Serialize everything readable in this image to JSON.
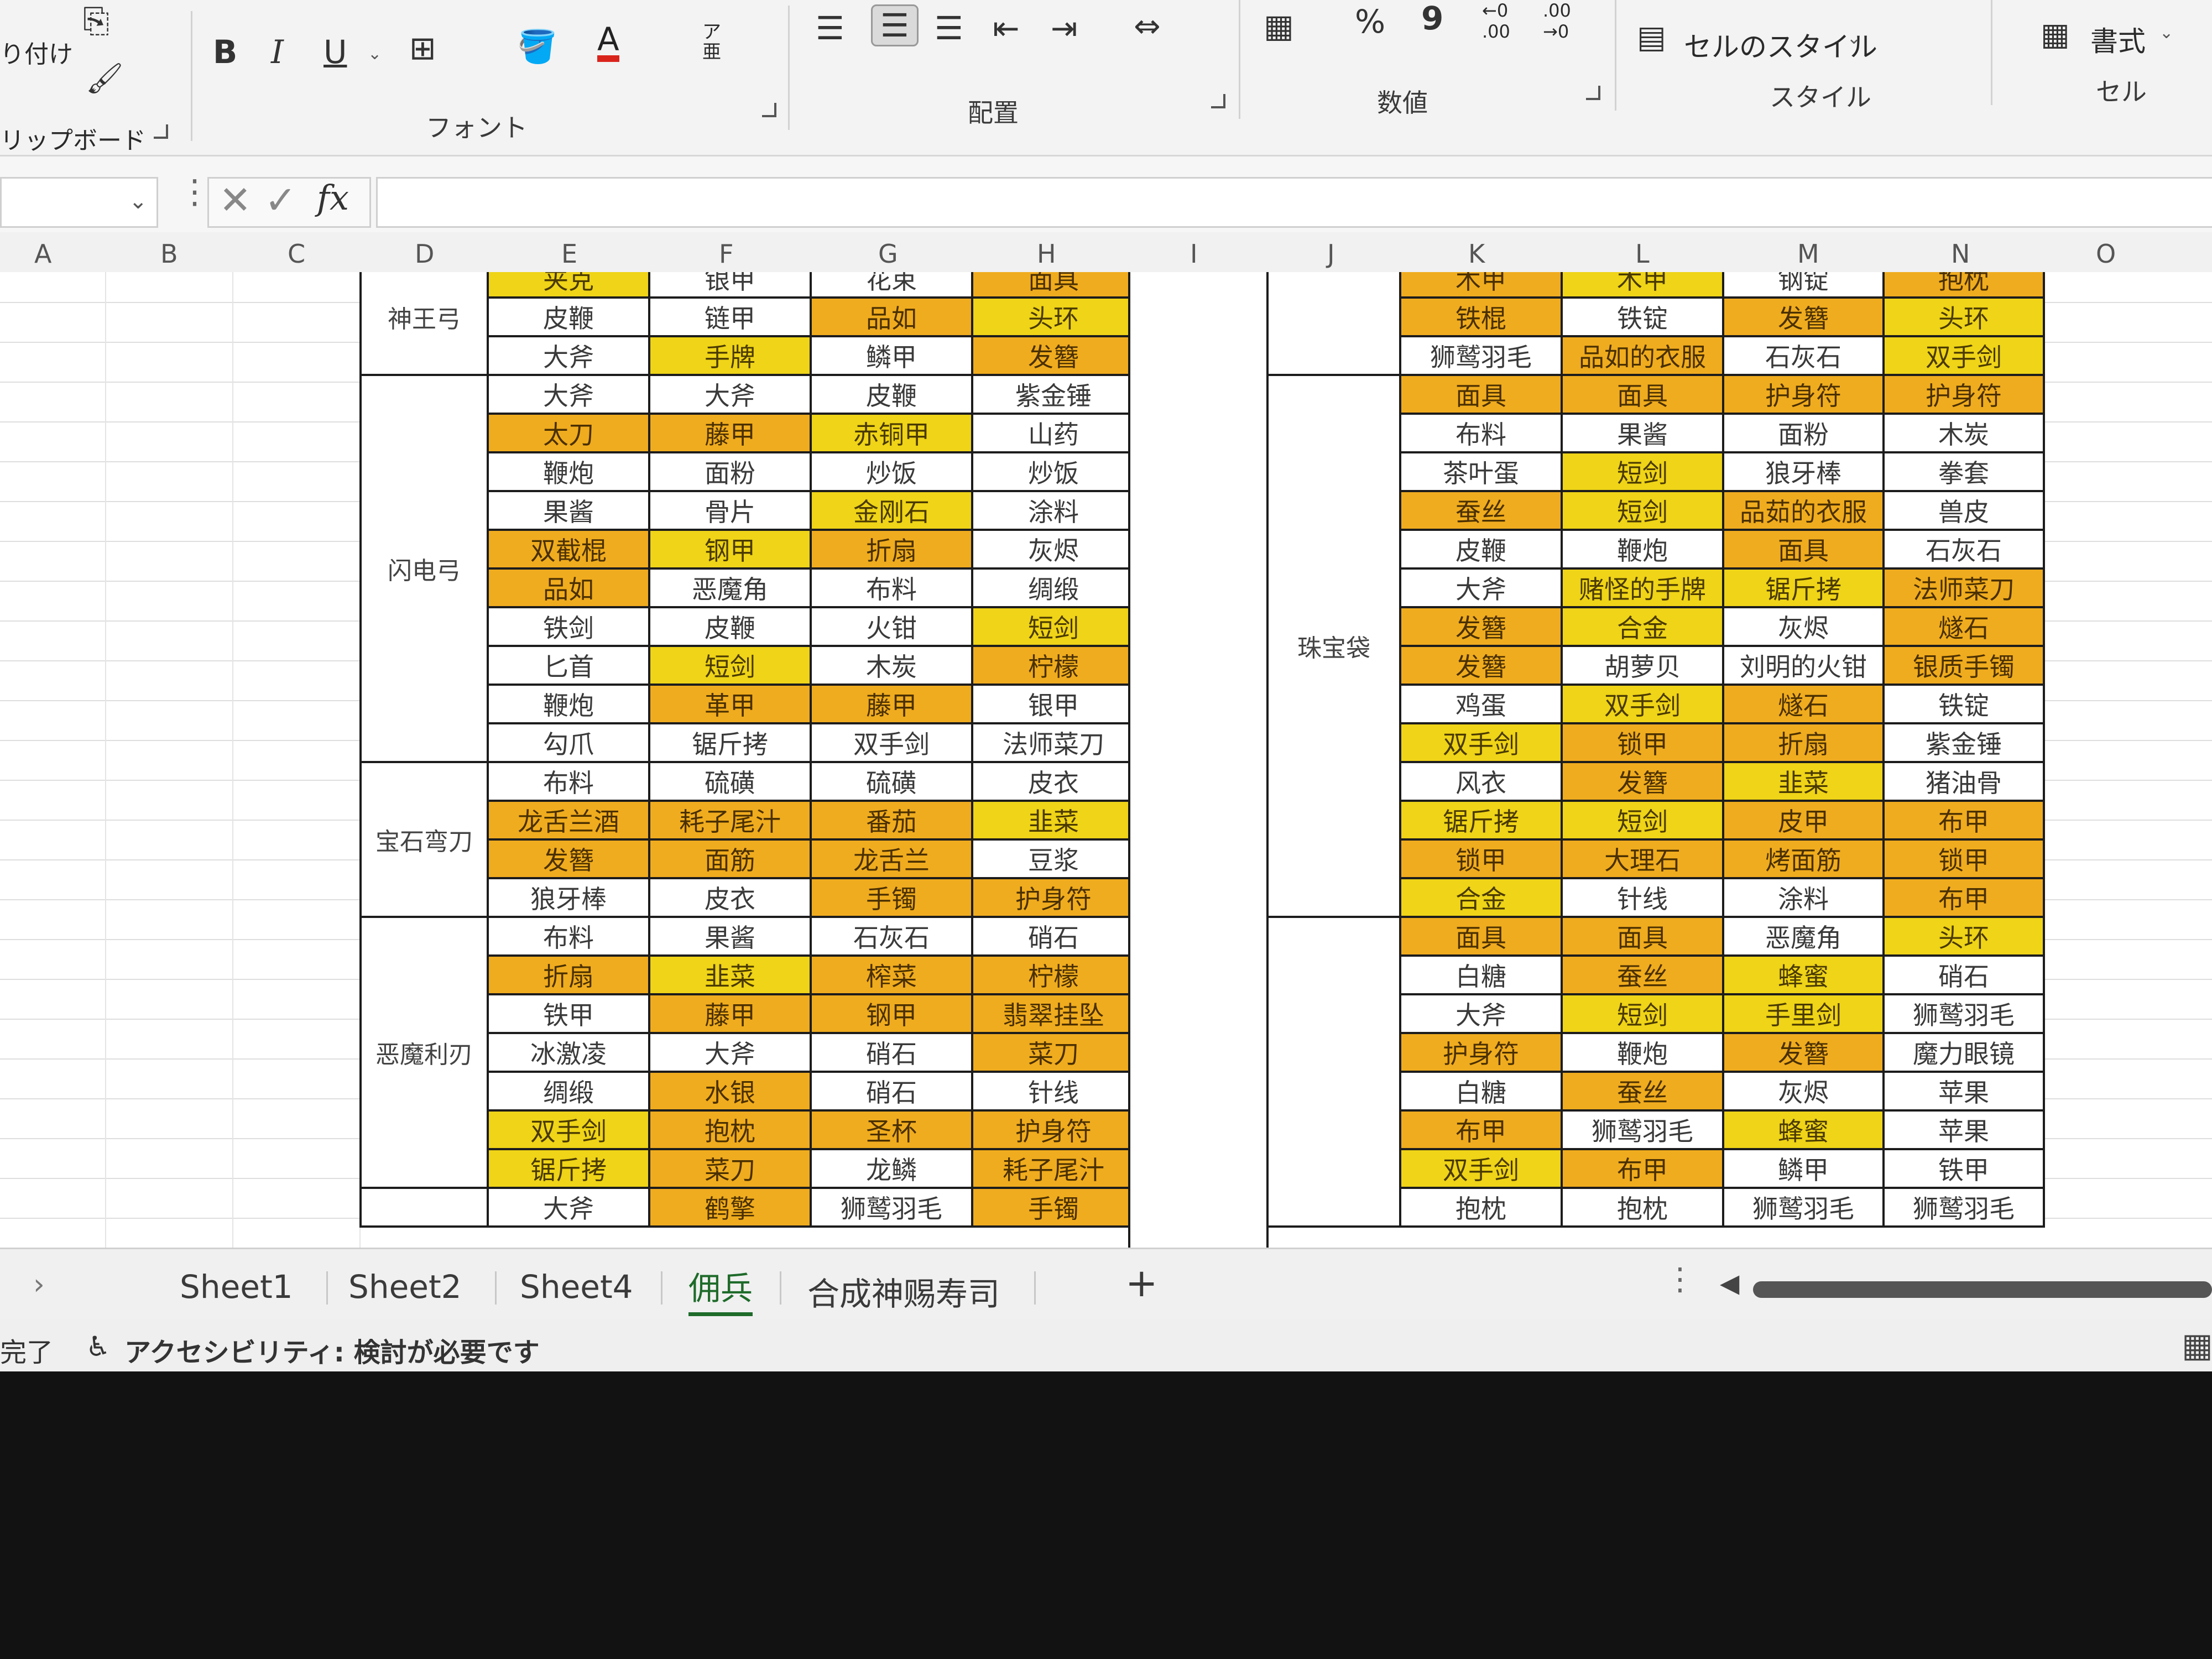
{
  "ribbon": {
    "paste_label": "り付け",
    "clipboard_group": "リップボード",
    "font_group": "フォント",
    "align_group": "配置",
    "number_group": "数値",
    "style_group": "スタイル",
    "cell_group": "セル",
    "bold": "B",
    "italic": "I",
    "underline": "U",
    "font_color": "A",
    "phonetic": "ア亜",
    "percent": "%",
    "comma": "9",
    "inc_decimal": "←0 .00",
    "dec_decimal": ".00 →0",
    "cell_styles": "セルのスタイル",
    "format": "書式"
  },
  "formula_bar": {
    "cancel": "✕",
    "enter": "✓",
    "fx": "fx",
    "value": ""
  },
  "column_headers": [
    "A",
    "B",
    "C",
    "D",
    "E",
    "F",
    "G",
    "H",
    "I",
    "J",
    "K",
    "L",
    "M",
    "N",
    "O"
  ],
  "left_table": {
    "groups": [
      {
        "name": "神王弓",
        "rows": 3
      },
      {
        "name": "闪电弓",
        "rows": 10
      },
      {
        "name": "宝石弯刀",
        "rows": 4
      },
      {
        "name": "恶魔利刃",
        "rows": 7
      },
      {
        "name": "",
        "rows": 1
      }
    ],
    "rows": [
      [
        [
          "夹克",
          "ye"
        ],
        [
          "银甲",
          "w"
        ],
        [
          "花束",
          "w"
        ],
        [
          "面具",
          "or"
        ]
      ],
      [
        [
          "皮鞭",
          "w"
        ],
        [
          "链甲",
          "w"
        ],
        [
          "品如",
          "or"
        ],
        [
          "头环",
          "ye"
        ]
      ],
      [
        [
          "大斧",
          "w"
        ],
        [
          "手牌",
          "ye"
        ],
        [
          "鳞甲",
          "w"
        ],
        [
          "发簪",
          "or"
        ]
      ],
      [
        [
          "大斧",
          "w"
        ],
        [
          "大斧",
          "w"
        ],
        [
          "皮鞭",
          "w"
        ],
        [
          "紫金锤",
          "w"
        ]
      ],
      [
        [
          "太刀",
          "or"
        ],
        [
          "藤甲",
          "or"
        ],
        [
          "赤铜甲",
          "ye"
        ],
        [
          "山药",
          "w"
        ]
      ],
      [
        [
          "鞭炮",
          "w"
        ],
        [
          "面粉",
          "w"
        ],
        [
          "炒饭",
          "w"
        ],
        [
          "炒饭",
          "w"
        ]
      ],
      [
        [
          "果酱",
          "w"
        ],
        [
          "骨片",
          "w"
        ],
        [
          "金刚石",
          "ye"
        ],
        [
          "涂料",
          "w"
        ]
      ],
      [
        [
          "双截棍",
          "or"
        ],
        [
          "钢甲",
          "ye"
        ],
        [
          "折扇",
          "or"
        ],
        [
          "灰烬",
          "w"
        ]
      ],
      [
        [
          "品如",
          "or"
        ],
        [
          "恶魔角",
          "w"
        ],
        [
          "布料",
          "w"
        ],
        [
          "绸缎",
          "w"
        ]
      ],
      [
        [
          "铁剑",
          "w"
        ],
        [
          "皮鞭",
          "w"
        ],
        [
          "火钳",
          "w"
        ],
        [
          "短剑",
          "ye"
        ]
      ],
      [
        [
          "匕首",
          "w"
        ],
        [
          "短剑",
          "ye"
        ],
        [
          "木炭",
          "w"
        ],
        [
          "柠檬",
          "or"
        ]
      ],
      [
        [
          "鞭炮",
          "w"
        ],
        [
          "革甲",
          "or"
        ],
        [
          "藤甲",
          "or"
        ],
        [
          "银甲",
          "w"
        ]
      ],
      [
        [
          "勾爪",
          "w"
        ],
        [
          "锯斤拷",
          "w"
        ],
        [
          "双手剑",
          "w"
        ],
        [
          "法师菜刀",
          "w"
        ]
      ],
      [
        [
          "布料",
          "w"
        ],
        [
          "硫磺",
          "w"
        ],
        [
          "硫磺",
          "w"
        ],
        [
          "皮衣",
          "w"
        ]
      ],
      [
        [
          "龙舌兰酒",
          "or"
        ],
        [
          "耗子尾汁",
          "or"
        ],
        [
          "番茄",
          "or"
        ],
        [
          "韭菜",
          "ye"
        ]
      ],
      [
        [
          "发簪",
          "or"
        ],
        [
          "面筋",
          "or"
        ],
        [
          "龙舌兰",
          "or"
        ],
        [
          "豆浆",
          "w"
        ]
      ],
      [
        [
          "狼牙棒",
          "w"
        ],
        [
          "皮衣",
          "w"
        ],
        [
          "手镯",
          "or"
        ],
        [
          "护身符",
          "or"
        ]
      ],
      [
        [
          "布料",
          "w"
        ],
        [
          "果酱",
          "w"
        ],
        [
          "石灰石",
          "w"
        ],
        [
          "硝石",
          "w"
        ]
      ],
      [
        [
          "折扇",
          "or"
        ],
        [
          "韭菜",
          "ye"
        ],
        [
          "榨菜",
          "or"
        ],
        [
          "柠檬",
          "or"
        ]
      ],
      [
        [
          "铁甲",
          "w"
        ],
        [
          "藤甲",
          "or"
        ],
        [
          "钢甲",
          "or"
        ],
        [
          "翡翠挂坠",
          "or"
        ]
      ],
      [
        [
          "冰激凌",
          "w"
        ],
        [
          "大斧",
          "w"
        ],
        [
          "硝石",
          "w"
        ],
        [
          "菜刀",
          "or"
        ]
      ],
      [
        [
          "绸缎",
          "w"
        ],
        [
          "水银",
          "or"
        ],
        [
          "硝石",
          "w"
        ],
        [
          "针线",
          "w"
        ]
      ],
      [
        [
          "双手剑",
          "ye"
        ],
        [
          "抱枕",
          "or"
        ],
        [
          "圣杯",
          "or"
        ],
        [
          "护身符",
          "or"
        ]
      ],
      [
        [
          "锯斤拷",
          "ye"
        ],
        [
          "菜刀",
          "or"
        ],
        [
          "龙鳞",
          "w"
        ],
        [
          "耗子尾汁",
          "or"
        ]
      ],
      [
        [
          "大斧",
          "w"
        ],
        [
          "鹤擎",
          "or"
        ],
        [
          "狮鹫羽毛",
          "w"
        ],
        [
          "手镯",
          "or"
        ]
      ]
    ]
  },
  "right_table": {
    "groups": [
      {
        "name": "",
        "rows": 3
      },
      {
        "name": "珠宝袋",
        "rows": 14
      },
      {
        "name": "",
        "rows": 8
      }
    ],
    "rows": [
      [
        [
          "木甲",
          "or"
        ],
        [
          "木甲",
          "ye"
        ],
        [
          "钢锭",
          "w"
        ],
        [
          "抱枕",
          "or"
        ]
      ],
      [
        [
          "铁棍",
          "or"
        ],
        [
          "铁锭",
          "w"
        ],
        [
          "发簪",
          "or"
        ],
        [
          "头环",
          "ye"
        ]
      ],
      [
        [
          "狮鹫羽毛",
          "w"
        ],
        [
          "品如的衣服",
          "or"
        ],
        [
          "石灰石",
          "w"
        ],
        [
          "双手剑",
          "ye"
        ]
      ],
      [
        [
          "面具",
          "or"
        ],
        [
          "面具",
          "or"
        ],
        [
          "护身符",
          "or"
        ],
        [
          "护身符",
          "or"
        ]
      ],
      [
        [
          "布料",
          "w"
        ],
        [
          "果酱",
          "w"
        ],
        [
          "面粉",
          "w"
        ],
        [
          "木炭",
          "w"
        ]
      ],
      [
        [
          "茶叶蛋",
          "w"
        ],
        [
          "短剑",
          "ye"
        ],
        [
          "狼牙棒",
          "w"
        ],
        [
          "拳套",
          "w"
        ]
      ],
      [
        [
          "蚕丝",
          "or"
        ],
        [
          "短剑",
          "ye"
        ],
        [
          "品茹的衣服",
          "or"
        ],
        [
          "兽皮",
          "w"
        ]
      ],
      [
        [
          "皮鞭",
          "w"
        ],
        [
          "鞭炮",
          "w"
        ],
        [
          "面具",
          "or"
        ],
        [
          "石灰石",
          "w"
        ]
      ],
      [
        [
          "大斧",
          "w"
        ],
        [
          "赌怪的手牌",
          "ye"
        ],
        [
          "锯斤拷",
          "ye"
        ],
        [
          "法师菜刀",
          "or"
        ]
      ],
      [
        [
          "发簪",
          "or"
        ],
        [
          "合金",
          "ye"
        ],
        [
          "灰烬",
          "w"
        ],
        [
          "燧石",
          "or"
        ]
      ],
      [
        [
          "发簪",
          "or"
        ],
        [
          "胡萝贝",
          "w"
        ],
        [
          "刘明的火钳",
          "w"
        ],
        [
          "银质手镯",
          "or"
        ]
      ],
      [
        [
          "鸡蛋",
          "w"
        ],
        [
          "双手剑",
          "ye"
        ],
        [
          "燧石",
          "or"
        ],
        [
          "铁锭",
          "w"
        ]
      ],
      [
        [
          "双手剑",
          "ye"
        ],
        [
          "锁甲",
          "or"
        ],
        [
          "折扇",
          "or"
        ],
        [
          "紫金锤",
          "w"
        ]
      ],
      [
        [
          "风衣",
          "w"
        ],
        [
          "发簪",
          "or"
        ],
        [
          "韭菜",
          "ye"
        ],
        [
          "猪油骨",
          "w"
        ]
      ],
      [
        [
          "锯斤拷",
          "ye"
        ],
        [
          "短剑",
          "ye"
        ],
        [
          "皮甲",
          "or"
        ],
        [
          "布甲",
          "or"
        ]
      ],
      [
        [
          "锁甲",
          "or"
        ],
        [
          "大理石",
          "or"
        ],
        [
          "烤面筋",
          "or"
        ],
        [
          "锁甲",
          "or"
        ]
      ],
      [
        [
          "合金",
          "ye"
        ],
        [
          "针线",
          "w"
        ],
        [
          "涂料",
          "w"
        ],
        [
          "布甲",
          "or"
        ]
      ],
      [
        [
          "面具",
          "or"
        ],
        [
          "面具",
          "or"
        ],
        [
          "恶魔角",
          "w"
        ],
        [
          "头环",
          "ye"
        ]
      ],
      [
        [
          "白糖",
          "w"
        ],
        [
          "蚕丝",
          "or"
        ],
        [
          "蜂蜜",
          "ye"
        ],
        [
          "硝石",
          "w"
        ]
      ],
      [
        [
          "大斧",
          "w"
        ],
        [
          "短剑",
          "ye"
        ],
        [
          "手里剑",
          "ye"
        ],
        [
          "狮鹫羽毛",
          "w"
        ]
      ],
      [
        [
          "护身符",
          "or"
        ],
        [
          "鞭炮",
          "w"
        ],
        [
          "发簪",
          "or"
        ],
        [
          "魔力眼镜",
          "w"
        ]
      ],
      [
        [
          "白糖",
          "w"
        ],
        [
          "蚕丝",
          "or"
        ],
        [
          "灰烬",
          "w"
        ],
        [
          "苹果",
          "w"
        ]
      ],
      [
        [
          "布甲",
          "or"
        ],
        [
          "狮鹫羽毛",
          "w"
        ],
        [
          "蜂蜜",
          "ye"
        ],
        [
          "苹果",
          "w"
        ]
      ],
      [
        [
          "双手剑",
          "ye"
        ],
        [
          "布甲",
          "or"
        ],
        [
          "鳞甲",
          "w"
        ],
        [
          "铁甲",
          "w"
        ]
      ],
      [
        [
          "抱枕",
          "w"
        ],
        [
          "抱枕",
          "w"
        ],
        [
          "狮鹫羽毛",
          "w"
        ],
        [
          "狮鹫羽毛",
          "w"
        ]
      ]
    ]
  },
  "sheet_tabs": [
    "Sheet1",
    "Sheet2",
    "Sheet4",
    "佣兵",
    "合成神赐寿司"
  ],
  "active_tab": "佣兵",
  "add_sheet": "+",
  "status": {
    "ready": "完了",
    "accessibility": "アクセシビリティ: 検討が必要です"
  },
  "colors": {
    "orange": "#f0ac1f",
    "yellow": "#efd418",
    "accent": "#1e6b2a"
  }
}
